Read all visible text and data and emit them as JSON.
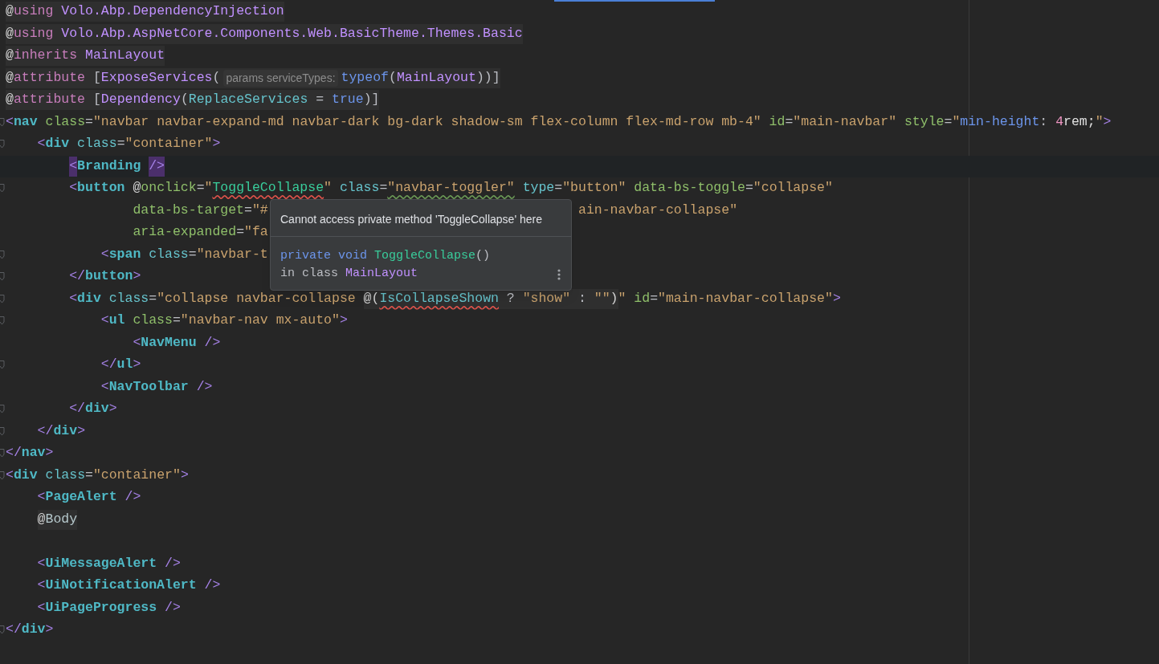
{
  "editor": {
    "lines": [
      {
        "kind": "code",
        "code_block": true,
        "tokens": [
          {
            "kind": "at",
            "text": "@"
          },
          {
            "kind": "dir",
            "text": "using"
          },
          {
            "kind": "ns",
            "text": " Volo.Abp.DependencyInjection"
          }
        ]
      },
      {
        "kind": "code",
        "code_block": true,
        "tokens": [
          {
            "kind": "at",
            "text": "@"
          },
          {
            "kind": "dir",
            "text": "using"
          },
          {
            "kind": "ns",
            "text": " Volo.Abp.AspNetCore.Components.Web.BasicTheme.Themes.Basic"
          }
        ]
      },
      {
        "kind": "code",
        "code_block": true,
        "tokens": [
          {
            "kind": "at",
            "text": "@"
          },
          {
            "kind": "dir",
            "text": "inherits"
          },
          {
            "kind": "type",
            "text": " MainLayout"
          }
        ]
      },
      {
        "kind": "code",
        "code_block": true,
        "tokens": [
          {
            "kind": "at",
            "text": "@"
          },
          {
            "kind": "dir",
            "text": "attribute"
          },
          {
            "kind": "punct",
            "text": " ["
          },
          {
            "kind": "type",
            "text": "ExposeServices"
          },
          {
            "kind": "punct",
            "text": "("
          },
          {
            "kind": "hint",
            "text": "params serviceTypes:"
          },
          {
            "kind": "kw",
            "text": "typeof"
          },
          {
            "kind": "punct",
            "text": "("
          },
          {
            "kind": "type",
            "text": "MainLayout"
          },
          {
            "kind": "punct",
            "text": "))]"
          }
        ]
      },
      {
        "kind": "code",
        "code_block": true,
        "tokens": [
          {
            "kind": "at",
            "text": "@"
          },
          {
            "kind": "dir",
            "text": "attribute"
          },
          {
            "kind": "punct",
            "text": " ["
          },
          {
            "kind": "type",
            "text": "Dependency"
          },
          {
            "kind": "punct",
            "text": "("
          },
          {
            "kind": "prop",
            "text": "ReplaceServices"
          },
          {
            "kind": "punct",
            "text": " = "
          },
          {
            "kind": "kw",
            "text": "true"
          },
          {
            "kind": "punct",
            "text": ")]"
          }
        ]
      },
      {
        "kind": "code",
        "fold": true,
        "tokens": [
          {
            "kind": "lt",
            "text": "<"
          },
          {
            "kind": "tag",
            "text": "nav"
          },
          {
            "kind": "attr",
            "text": " class"
          },
          {
            "kind": "punct",
            "text": "="
          },
          {
            "kind": "str",
            "text": "\"navbar navbar-expand-md navbar-dark bg-dark shadow-sm flex-column flex-md-row mb-4\""
          },
          {
            "kind": "attr",
            "text": " id"
          },
          {
            "kind": "punct",
            "text": "="
          },
          {
            "kind": "str",
            "text": "\"main-navbar\""
          },
          {
            "kind": "attr",
            "text": " style"
          },
          {
            "kind": "punct",
            "text": "="
          },
          {
            "kind": "str",
            "text": "\""
          },
          {
            "kind": "css",
            "text": "min-height"
          },
          {
            "kind": "punct",
            "text": ": "
          },
          {
            "kind": "num",
            "text": "4"
          },
          {
            "kind": "white",
            "text": "rem;"
          },
          {
            "kind": "str",
            "text": "\""
          },
          {
            "kind": "lt",
            "text": ">"
          }
        ],
        "children": [
          {
            "kind": "code",
            "fold": true,
            "tokens": [
              {
                "kind": "lt",
                "text": "<"
              },
              {
                "kind": "tag",
                "text": "div"
              },
              {
                "kind": "attr2",
                "text": " class"
              },
              {
                "kind": "punct",
                "text": "="
              },
              {
                "kind": "str",
                "text": "\"container\""
              },
              {
                "kind": "lt",
                "text": ">"
              }
            ],
            "children": [
              {
                "kind": "code",
                "current": true,
                "tokens": [
                  {
                    "kind": "lt",
                    "text": "<",
                    "highlight": true
                  },
                  {
                    "kind": "tag",
                    "text": "Branding "
                  },
                  {
                    "kind": "lt",
                    "text": "/>",
                    "highlight": true
                  }
                ]
              },
              {
                "kind": "code",
                "fold": true,
                "tokens": [
                  {
                    "kind": "lt",
                    "text": "<"
                  },
                  {
                    "kind": "tag",
                    "text": "button"
                  },
                  {
                    "kind": "at",
                    "text": " @"
                  },
                  {
                    "kind": "attr",
                    "text": "onclick"
                  },
                  {
                    "kind": "punct",
                    "text": "="
                  },
                  {
                    "kind": "str",
                    "text": "\""
                  },
                  {
                    "kind": "method",
                    "text": "ToggleCollapse",
                    "error_underline": true
                  },
                  {
                    "kind": "str",
                    "text": "\""
                  },
                  {
                    "kind": "attr2",
                    "text": " class"
                  },
                  {
                    "kind": "punct",
                    "text": "="
                  },
                  {
                    "kind": "str",
                    "text": "\"navbar-toggler\"",
                    "warning_underline": true
                  },
                  {
                    "kind": "attr2",
                    "text": " type"
                  },
                  {
                    "kind": "punct",
                    "text": "="
                  },
                  {
                    "kind": "str",
                    "text": "\"button\""
                  },
                  {
                    "kind": "attr",
                    "text": " data-bs-toggle"
                  },
                  {
                    "kind": "punct",
                    "text": "="
                  },
                  {
                    "kind": "str",
                    "text": "\"collapse\""
                  }
                ],
                "continuation": [
                  {
                    "kind": "code",
                    "tokens": [
                      {
                        "kind": "attr",
                        "text": "data-bs-target"
                      },
                      {
                        "kind": "punct",
                        "text": "="
                      },
                      {
                        "kind": "str",
                        "text": "\"#"
                      }
                    ],
                    "after_popup": [
                      {
                        "kind": "str",
                        "text": "ain-navbar-collapse\""
                      }
                    ]
                  },
                  {
                    "kind": "code",
                    "tokens": [
                      {
                        "kind": "attr",
                        "text": "aria-expanded"
                      },
                      {
                        "kind": "punct",
                        "text": "="
                      },
                      {
                        "kind": "str",
                        "text": "\"fa"
                      }
                    ]
                  }
                ],
                "children": [
                  {
                    "kind": "code",
                    "fold": true,
                    "tokens": [
                      {
                        "kind": "lt",
                        "text": "<"
                      },
                      {
                        "kind": "tag",
                        "text": "span"
                      },
                      {
                        "kind": "attr2",
                        "text": " class"
                      },
                      {
                        "kind": "punct",
                        "text": "="
                      },
                      {
                        "kind": "str",
                        "text": "\"navbar-t"
                      }
                    ]
                  }
                ]
              },
              {
                "kind": "code",
                "fold": true,
                "tokens": [
                  {
                    "kind": "lt",
                    "text": "</"
                  },
                  {
                    "kind": "tag",
                    "text": "button"
                  },
                  {
                    "kind": "lt",
                    "text": ">"
                  }
                ]
              },
              {
                "kind": "code",
                "fold": true,
                "tokens": [
                  {
                    "kind": "lt",
                    "text": "<"
                  },
                  {
                    "kind": "tag",
                    "text": "div"
                  },
                  {
                    "kind": "attr2",
                    "text": " class"
                  },
                  {
                    "kind": "punct",
                    "text": "="
                  },
                  {
                    "kind": "str",
                    "text": "\"collapse navbar-collapse "
                  },
                  {
                    "kind": "at",
                    "text": "@(",
                    "block": true
                  },
                  {
                    "kind": "prop",
                    "text": "IsCollapseShown",
                    "error_underline": true,
                    "block": true
                  },
                  {
                    "kind": "punct",
                    "text": " ? ",
                    "block": true
                  },
                  {
                    "kind": "str",
                    "text": "\"show\"",
                    "block": true
                  },
                  {
                    "kind": "punct",
                    "text": " : ",
                    "block": true
                  },
                  {
                    "kind": "str",
                    "text": "\"\"",
                    "block": true
                  },
                  {
                    "kind": "at",
                    "text": ")",
                    "block": true
                  },
                  {
                    "kind": "str",
                    "text": "\""
                  },
                  {
                    "kind": "attr",
                    "text": " id"
                  },
                  {
                    "kind": "punct",
                    "text": "="
                  },
                  {
                    "kind": "str",
                    "text": "\"main-navbar-collapse\""
                  },
                  {
                    "kind": "lt",
                    "text": ">"
                  }
                ],
                "children": [
                  {
                    "kind": "code",
                    "fold": true,
                    "tokens": [
                      {
                        "kind": "lt",
                        "text": "<"
                      },
                      {
                        "kind": "tag",
                        "text": "ul"
                      },
                      {
                        "kind": "attr",
                        "text": " class"
                      },
                      {
                        "kind": "punct",
                        "text": "="
                      },
                      {
                        "kind": "str",
                        "text": "\"navbar-nav mx-auto\""
                      },
                      {
                        "kind": "lt",
                        "text": ">"
                      }
                    ],
                    "children": [
                      {
                        "kind": "code",
                        "tokens": [
                          {
                            "kind": "lt",
                            "text": "<"
                          },
                          {
                            "kind": "tag",
                            "text": "NavMenu"
                          },
                          {
                            "kind": "lt",
                            "text": " />"
                          }
                        ]
                      }
                    ]
                  },
                  {
                    "kind": "code",
                    "fold": true,
                    "tokens": [
                      {
                        "kind": "lt",
                        "text": "</"
                      },
                      {
                        "kind": "tag",
                        "text": "ul"
                      },
                      {
                        "kind": "lt",
                        "text": ">"
                      }
                    ]
                  },
                  {
                    "kind": "code",
                    "tokens": [
                      {
                        "kind": "lt",
                        "text": "<"
                      },
                      {
                        "kind": "tag",
                        "text": "NavToolbar"
                      },
                      {
                        "kind": "lt",
                        "text": " />"
                      }
                    ]
                  }
                ]
              },
              {
                "kind": "code",
                "fold": true,
                "tokens": [
                  {
                    "kind": "lt",
                    "text": "</"
                  },
                  {
                    "kind": "tag",
                    "text": "div"
                  },
                  {
                    "kind": "lt",
                    "text": ">"
                  }
                ]
              }
            ]
          },
          {
            "kind": "code",
            "fold": true,
            "tokens": [
              {
                "kind": "lt",
                "text": "</"
              },
              {
                "kind": "tag",
                "text": "div"
              },
              {
                "kind": "lt",
                "text": ">"
              }
            ]
          }
        ]
      },
      {
        "kind": "code",
        "fold": true,
        "tokens": [
          {
            "kind": "lt",
            "text": "</"
          },
          {
            "kind": "tag",
            "text": "nav"
          },
          {
            "kind": "lt",
            "text": ">"
          }
        ]
      },
      {
        "kind": "code",
        "fold": true,
        "tokens": [
          {
            "kind": "lt",
            "text": "<"
          },
          {
            "kind": "tag",
            "text": "div"
          },
          {
            "kind": "attr2",
            "text": " class"
          },
          {
            "kind": "punct",
            "text": "="
          },
          {
            "kind": "str",
            "text": "\"container\""
          },
          {
            "kind": "lt",
            "text": ">"
          }
        ],
        "children": [
          {
            "kind": "code",
            "tokens": [
              {
                "kind": "lt",
                "text": "<"
              },
              {
                "kind": "tag",
                "text": "PageAlert"
              },
              {
                "kind": "lt",
                "text": " />"
              }
            ]
          },
          {
            "kind": "code",
            "tokens": [
              {
                "kind": "at",
                "text": "@",
                "block": true
              },
              {
                "kind": "member",
                "text": "Body",
                "block": true
              }
            ]
          },
          {
            "kind": "blank"
          },
          {
            "kind": "code",
            "tokens": [
              {
                "kind": "lt",
                "text": "<"
              },
              {
                "kind": "tag",
                "text": "UiMessageAlert"
              },
              {
                "kind": "lt",
                "text": " />"
              }
            ]
          },
          {
            "kind": "code",
            "tokens": [
              {
                "kind": "lt",
                "text": "<"
              },
              {
                "kind": "tag",
                "text": "UiNotificationAlert"
              },
              {
                "kind": "lt",
                "text": " />"
              }
            ]
          },
          {
            "kind": "code",
            "tokens": [
              {
                "kind": "lt",
                "text": "<"
              },
              {
                "kind": "tag",
                "text": "UiPageProgress"
              },
              {
                "kind": "lt",
                "text": " />"
              }
            ]
          }
        ]
      },
      {
        "kind": "code",
        "fold": true,
        "tokens": [
          {
            "kind": "lt",
            "text": "</"
          },
          {
            "kind": "tag",
            "text": "div"
          },
          {
            "kind": "lt",
            "text": ">"
          }
        ]
      }
    ]
  },
  "popup": {
    "message": "Cannot access private method 'ToggleCollapse' here",
    "signature": [
      {
        "kind": "kw",
        "text": "private"
      },
      {
        "kind": "kw",
        "text": " void"
      },
      {
        "kind": "method",
        "text": " ToggleCollapse"
      },
      {
        "kind": "punct",
        "text": "()"
      }
    ],
    "location": [
      {
        "kind": "punct",
        "text": "in class "
      },
      {
        "kind": "type",
        "text": "MainLayout"
      }
    ]
  }
}
